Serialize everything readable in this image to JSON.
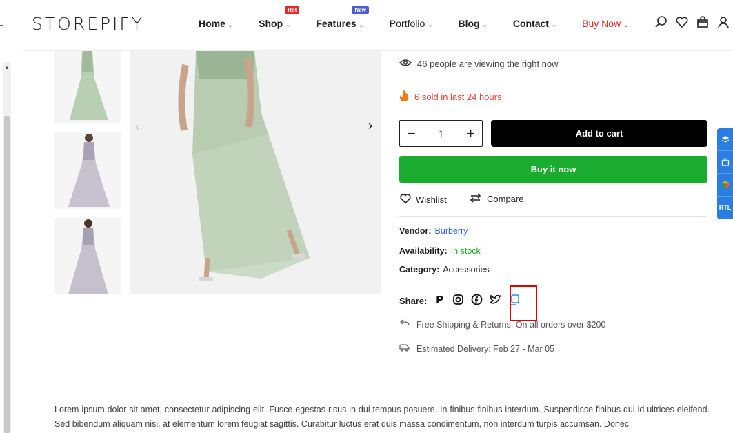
{
  "header": {
    "logo": "STOREPIFY",
    "nav": [
      {
        "label": "Home",
        "chevron": "⌄"
      },
      {
        "label": "Shop",
        "chevron": "⌄",
        "badge": "Hot"
      },
      {
        "label": "Features",
        "chevron": "⌄",
        "badge": "New"
      },
      {
        "label": "Portfolio",
        "chevron": "⌄"
      },
      {
        "label": "Blog",
        "chevron": "⌄"
      },
      {
        "label": "Contact",
        "chevron": "⌄"
      },
      {
        "label": "Buy Now",
        "chevron": "⌄"
      }
    ],
    "icons": [
      "search-icon",
      "heart-icon",
      "bag-icon",
      "user-icon"
    ]
  },
  "gallery": {
    "prev_arrow": "‹",
    "next_arrow": "›"
  },
  "product": {
    "viewing_text": "46 people are viewing the right now",
    "sold_text": "6 sold in last 24 hours",
    "quantity": "1",
    "minus": "−",
    "plus": "+",
    "add_to_cart": "Add to cart",
    "buy_now": "Buy it now",
    "wishlist": "Wishlist",
    "compare": "Compare",
    "vendor_label": "Vendor:",
    "vendor_value": "Burberry",
    "availability_label": "Availability:",
    "availability_value": "In stock",
    "category_label": "Category:",
    "category_value": "Accessories",
    "share_label": "Share:",
    "shipping_text": "Free Shipping & Returns: On all orders over $200",
    "delivery_text": "Estimated Delivery: Feb 27 - Mar 05"
  },
  "side_tools": {
    "rtl_label": "RTL"
  },
  "description": "Lorem ipsum dolor sit amet, consectetur adipiscing elit. Fusce egestas risus in dui tempus posuere. In finibus finibus interdum. Suspendisse finibus dui id ultrices eleifend. Sed bibendum aliquam nisi, at elementum lorem feugiat sagittis. Curabitur luctus erat quis massa condimentum, non interdum turpis accumsan. Donec",
  "colors": {
    "accent_red": "#e02b27",
    "buy_green": "#1aac2e",
    "link_blue": "#2a6bd6",
    "side_blue": "#2a7de1"
  }
}
